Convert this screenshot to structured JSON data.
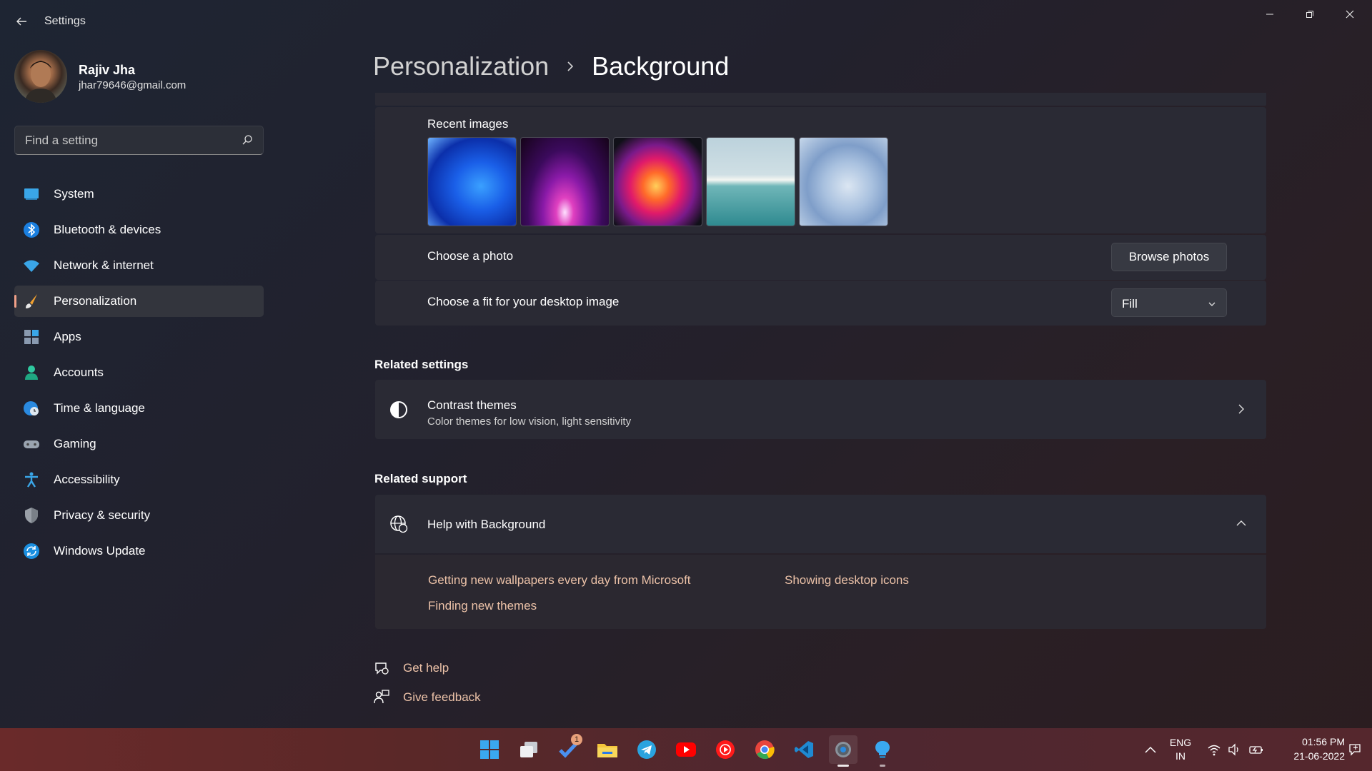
{
  "window": {
    "title": "Settings"
  },
  "profile": {
    "name": "Rajiv Jha",
    "email": "jhar79646@gmail.com"
  },
  "search": {
    "placeholder": "Find a setting"
  },
  "nav": {
    "items": [
      {
        "label": "System",
        "icon": "system-icon",
        "selected": false
      },
      {
        "label": "Bluetooth & devices",
        "icon": "bluetooth-icon",
        "selected": false
      },
      {
        "label": "Network & internet",
        "icon": "wifi-icon",
        "selected": false
      },
      {
        "label": "Personalization",
        "icon": "brush-icon",
        "selected": true
      },
      {
        "label": "Apps",
        "icon": "apps-icon",
        "selected": false
      },
      {
        "label": "Accounts",
        "icon": "person-icon",
        "selected": false
      },
      {
        "label": "Time & language",
        "icon": "globe-clock-icon",
        "selected": false
      },
      {
        "label": "Gaming",
        "icon": "gamepad-icon",
        "selected": false
      },
      {
        "label": "Accessibility",
        "icon": "accessibility-icon",
        "selected": false
      },
      {
        "label": "Privacy & security",
        "icon": "shield-icon",
        "selected": false
      },
      {
        "label": "Windows Update",
        "icon": "update-icon",
        "selected": false
      }
    ]
  },
  "header": {
    "parent": "Personalization",
    "current": "Background"
  },
  "background": {
    "recent_label": "Recent images",
    "choose_photo_label": "Choose a photo",
    "browse_button": "Browse photos",
    "fit_label": "Choose a fit for your desktop image",
    "fit_value": "Fill"
  },
  "related_settings": {
    "title": "Related settings",
    "contrast_title": "Contrast themes",
    "contrast_subtitle": "Color themes for low vision, light sensitivity"
  },
  "related_support": {
    "title": "Related support",
    "help_title": "Help with Background",
    "links": [
      "Getting new wallpapers every day from Microsoft",
      "Showing desktop icons",
      "Finding new themes"
    ]
  },
  "footer": {
    "get_help": "Get help",
    "give_feedback": "Give feedback"
  },
  "taskbar": {
    "badge_count": "1",
    "lang_line1": "ENG",
    "lang_line2": "IN",
    "time": "01:56 PM",
    "date": "21-06-2022"
  },
  "colors": {
    "accent": "#ecc2a8",
    "selection_bar": "#f0a088",
    "taskbar": "#5a2828"
  }
}
